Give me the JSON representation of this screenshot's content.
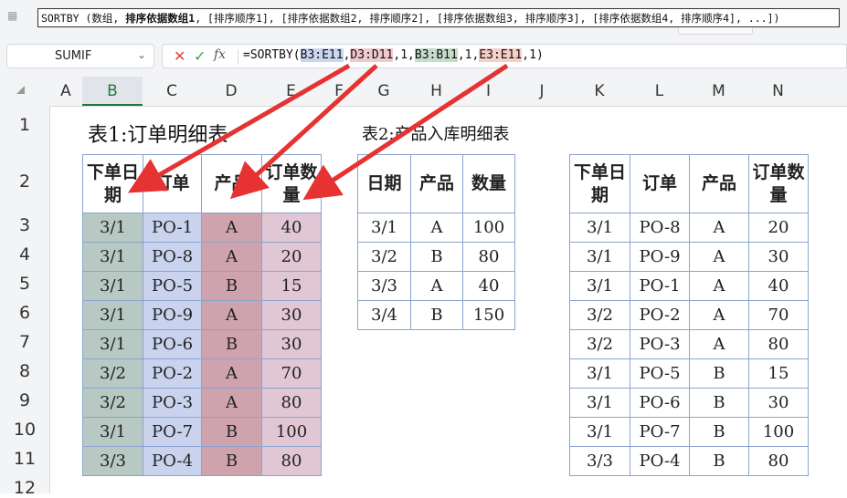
{
  "tooltip": {
    "fn": "SORTBY",
    "p0": " (数组,",
    "p1": " 排序依据数组1",
    "p2": ", [排序顺序1], [排序依据数组2, 排序顺序2], [排序依据数组3, 排序顺序3], [排序依据数组4, 排序顺序4], ...])"
  },
  "namebox": {
    "value": "SUMIF"
  },
  "formula": {
    "prefix": "=SORTBY(",
    "ref1": "B3:E11",
    "c1": ",",
    "ref2": "D3:D11",
    "c2": ",1,",
    "ref3": "B3:B11",
    "c3": ",1,",
    "ref4": "E3:E11",
    "suffix": ",1)"
  },
  "columns": [
    "A",
    "B",
    "C",
    "D",
    "E",
    "F",
    "G",
    "H",
    "I",
    "J",
    "K",
    "L",
    "M",
    "N"
  ],
  "rows": [
    "1",
    "2",
    "3",
    "4",
    "5",
    "6",
    "7",
    "8",
    "9",
    "10",
    "11",
    "12"
  ],
  "titles": {
    "t1": "表1:订单明细表",
    "t2": "表2:产品入库明细表"
  },
  "table1": {
    "headers": [
      "下单日期",
      "订单",
      "产品",
      "订单数量"
    ],
    "rows": [
      [
        "3/1",
        "PO-1",
        "A",
        "40"
      ],
      [
        "3/1",
        "PO-8",
        "A",
        "20"
      ],
      [
        "3/1",
        "PO-5",
        "B",
        "15"
      ],
      [
        "3/1",
        "PO-9",
        "A",
        "30"
      ],
      [
        "3/1",
        "PO-6",
        "B",
        "30"
      ],
      [
        "3/2",
        "PO-2",
        "A",
        "70"
      ],
      [
        "3/2",
        "PO-3",
        "A",
        "80"
      ],
      [
        "3/1",
        "PO-7",
        "B",
        "100"
      ],
      [
        "3/3",
        "PO-4",
        "B",
        "80"
      ]
    ]
  },
  "table2": {
    "headers": [
      "日期",
      "产品",
      "数量"
    ],
    "rows": [
      [
        "3/1",
        "A",
        "100"
      ],
      [
        "3/2",
        "B",
        "80"
      ],
      [
        "3/3",
        "A",
        "40"
      ],
      [
        "3/4",
        "B",
        "150"
      ]
    ]
  },
  "table3": {
    "headers": [
      "下单日期",
      "订单",
      "产品",
      "订单数量"
    ],
    "rows": [
      [
        "3/1",
        "PO-8",
        "A",
        "20"
      ],
      [
        "3/1",
        "PO-9",
        "A",
        "30"
      ],
      [
        "3/1",
        "PO-1",
        "A",
        "40"
      ],
      [
        "3/2",
        "PO-2",
        "A",
        "70"
      ],
      [
        "3/2",
        "PO-3",
        "A",
        "80"
      ],
      [
        "3/1",
        "PO-5",
        "B",
        "15"
      ],
      [
        "3/1",
        "PO-6",
        "B",
        "30"
      ],
      [
        "3/1",
        "PO-7",
        "B",
        "100"
      ],
      [
        "3/3",
        "PO-4",
        "B",
        "80"
      ]
    ]
  },
  "colors": {
    "arrow": "#e63232",
    "border": "#8aa3cf",
    "active": "#1f7a3a"
  }
}
